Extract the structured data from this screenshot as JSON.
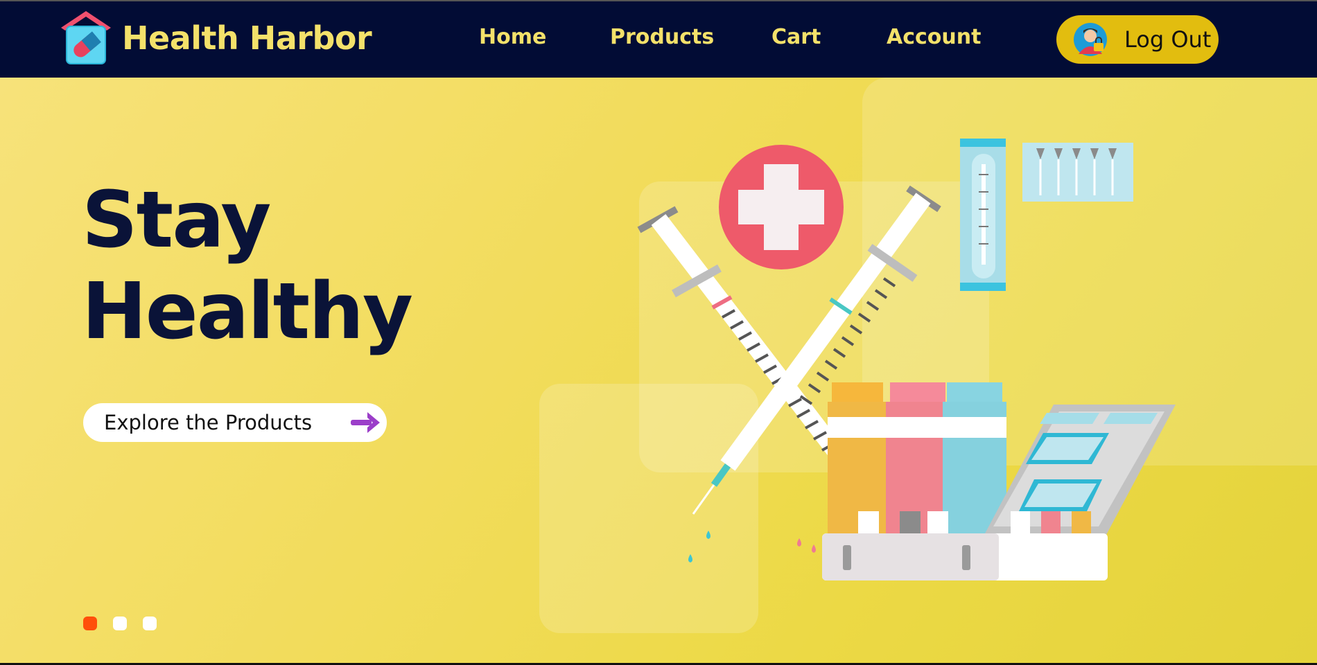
{
  "brand": {
    "name": "Health Harbor",
    "logo_icon": "house-pill-icon"
  },
  "nav": {
    "items": [
      {
        "label": "Home"
      },
      {
        "label": "Products"
      },
      {
        "label": "Cart"
      },
      {
        "label": "Account"
      }
    ],
    "logout": {
      "label": "Log Out",
      "avatar_icon": "user-lock-avatar-icon"
    }
  },
  "hero": {
    "title_line1": "Stay",
    "title_line2": "Healthy",
    "cta_label": "Explore the Products",
    "cta_icon": "arrow-right-icon",
    "carousel": {
      "total": 3,
      "active_index": 0
    },
    "illustration_icon": "medical-supplies-illustration"
  },
  "colors": {
    "navbar_bg": "#020c35",
    "brand_text": "#f4e16a",
    "logout_bg": "#e2bd0f",
    "hero_bg": "#f2dc5c",
    "title_text": "#0a1338",
    "dot_active": "#ff4f0a",
    "dot_inactive": "#ffffff",
    "arrow": "#9b3ec9"
  }
}
